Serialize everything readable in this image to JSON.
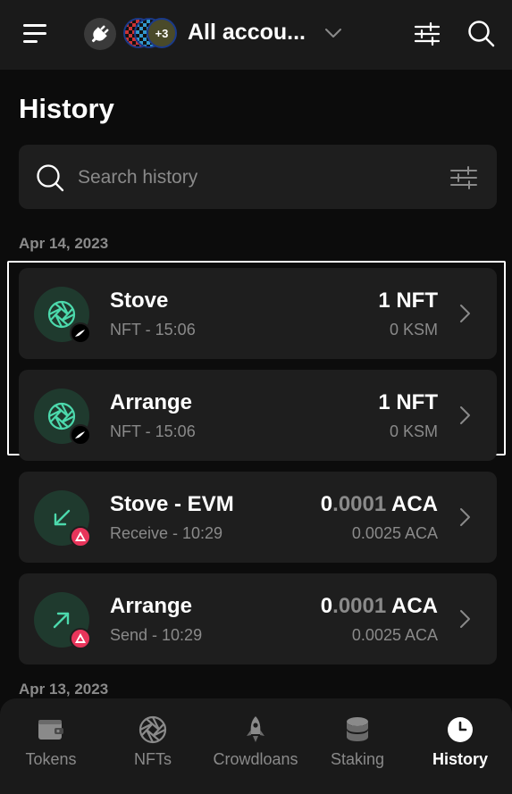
{
  "header": {
    "account_label": "All accou...",
    "avatar_extra": "+3"
  },
  "page": {
    "title": "History"
  },
  "search": {
    "placeholder": "Search history"
  },
  "groups": [
    {
      "date": "Apr 14, 2023"
    },
    {
      "date": "Apr 13, 2023"
    }
  ],
  "items": [
    {
      "name": "Stove",
      "sub": "NFT - 15:06",
      "amount": "1 NFT",
      "fee": "0 KSM",
      "icon": "nft-icon",
      "chain": "kusama-badge-icon"
    },
    {
      "name": "Arrange",
      "sub": "NFT - 15:06",
      "amount": "1 NFT",
      "fee": "0 KSM",
      "icon": "nft-icon",
      "chain": "kusama-badge-icon"
    },
    {
      "name": "Stove - EVM",
      "sub": "Receive - 10:29",
      "amount_int": "0",
      "amount_dec": ".0001",
      "amount_unit": " ACA",
      "fee": "0.0025 ACA",
      "icon": "receive-arrow-icon",
      "chain": "acala-badge-icon"
    },
    {
      "name": "Arrange",
      "sub": "Send - 10:29",
      "amount_int": "0",
      "amount_dec": ".0001",
      "amount_unit": " ACA",
      "fee": "0.0025 ACA",
      "icon": "send-arrow-icon",
      "chain": "acala-badge-icon"
    }
  ],
  "nav": [
    {
      "label": "Tokens",
      "icon": "wallet-icon"
    },
    {
      "label": "NFTs",
      "icon": "aperture-icon"
    },
    {
      "label": "Crowdloans",
      "icon": "rocket-icon"
    },
    {
      "label": "Staking",
      "icon": "database-icon"
    },
    {
      "label": "History",
      "icon": "clock-icon",
      "active": true
    }
  ],
  "colors": {
    "background": "#0c0c0c",
    "surface": "#1e1e1e",
    "accent_green": "#4cd9ac",
    "muted_text": "#8a8a8a",
    "acala_pink": "#e8355b"
  }
}
